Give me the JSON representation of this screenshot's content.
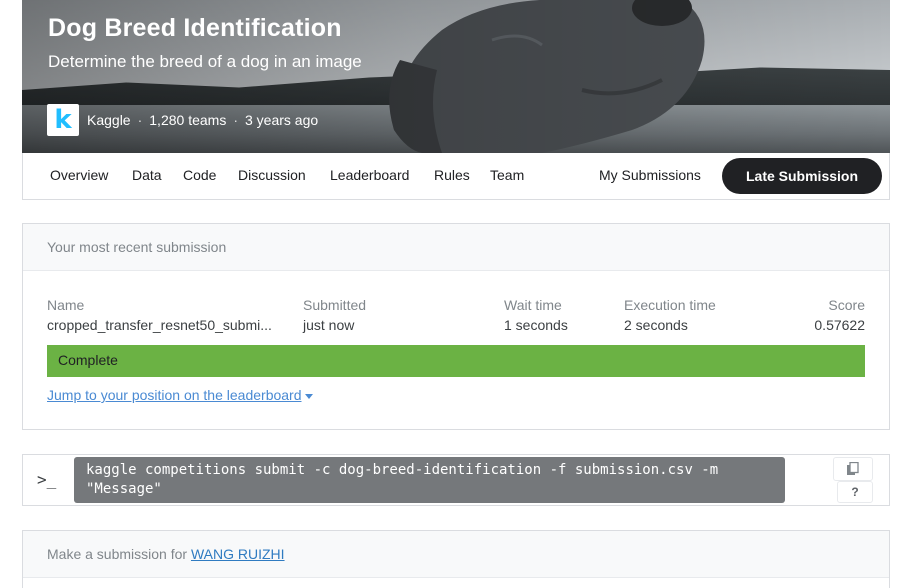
{
  "competition": {
    "title": "Dog Breed Identification",
    "subtitle": "Determine the breed of a dog in an image",
    "host_logo": "k",
    "host": "Kaggle",
    "separator": "·",
    "teams": "1,280 teams",
    "age": "3 years ago"
  },
  "tabs": [
    {
      "label": "Overview"
    },
    {
      "label": "Data"
    },
    {
      "label": "Code"
    },
    {
      "label": "Discussion"
    },
    {
      "label": "Leaderboard"
    },
    {
      "label": "Rules"
    },
    {
      "label": "Team"
    }
  ],
  "nav": {
    "my_submissions": "My Submissions",
    "late_submission": "Late Submission"
  },
  "recent_submission": {
    "heading": "Your most recent submission",
    "columns": {
      "name": {
        "label": "Name",
        "value": "cropped_transfer_resnet50_submi..."
      },
      "submitted": {
        "label": "Submitted",
        "value": "just now"
      },
      "wait_time": {
        "label": "Wait time",
        "value": "1 seconds"
      },
      "execution_time": {
        "label": "Execution time",
        "value": "2 seconds"
      },
      "score": {
        "label": "Score",
        "value": "0.57622"
      }
    },
    "status": "Complete",
    "status_color": "#6bb244",
    "jump_link": "Jump to your position on the leaderboard"
  },
  "cli": {
    "prompt_icon": "terminal-prompt",
    "prompt_glyph": ">_",
    "command_line1": "kaggle competitions submit -c dog-breed-identification -f submission.csv -m",
    "command_line2": "\"Message\"",
    "copy_icon": "copy-icon",
    "help_label": "?"
  },
  "make_submission": {
    "prefix": "Make a submission for",
    "team": "WANG RUIZHI"
  },
  "colors": {
    "accent_dark": "#202124",
    "link": "#4a8ad3",
    "kaggle_blue": "#20beff"
  }
}
